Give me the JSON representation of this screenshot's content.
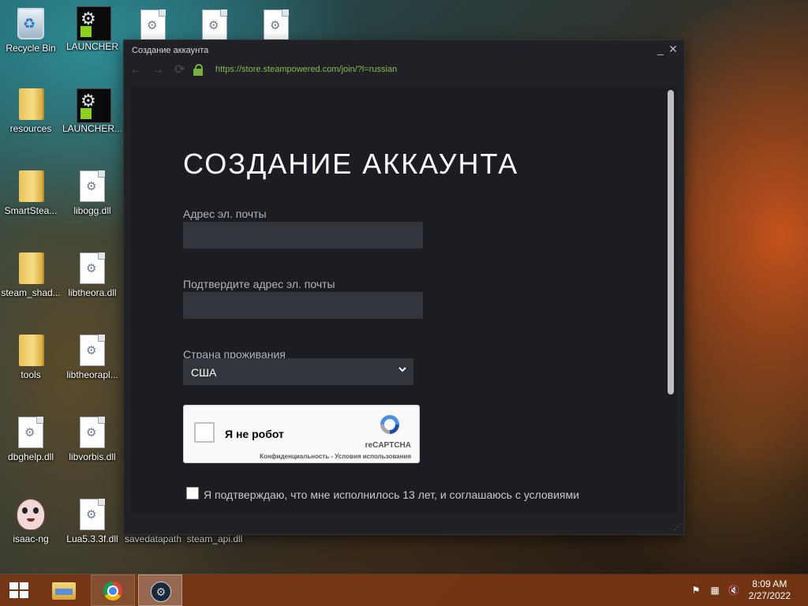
{
  "desktop": {
    "icons": [
      {
        "label": "Recycle Bin",
        "icon": "recycle-bin-icon"
      },
      {
        "label": "LAUNCHER",
        "icon": "steam-launcher-icon"
      },
      {
        "label": "resources",
        "icon": "folder-icon"
      },
      {
        "label": "LAUNCHER...",
        "icon": "steam-launcher-icon"
      },
      {
        "label": "SmartStea...",
        "icon": "folder-icon"
      },
      {
        "label": "libogg.dll",
        "icon": "dll-file-icon"
      },
      {
        "label": "steam_shad...",
        "icon": "folder-icon"
      },
      {
        "label": "libtheora.dll",
        "icon": "dll-file-icon"
      },
      {
        "label": "tools",
        "icon": "folder-icon"
      },
      {
        "label": "libtheorapl...",
        "icon": "dll-file-icon"
      },
      {
        "label": "dbghelp.dll",
        "icon": "dll-file-icon"
      },
      {
        "label": "libvorbis.dll",
        "icon": "dll-file-icon"
      },
      {
        "label": "isaac-ng",
        "icon": "isaac-game-icon"
      },
      {
        "label": "Lua5.3.3f.dll",
        "icon": "dll-file-icon"
      },
      {
        "label": "savedatapath",
        "icon": "file-icon"
      },
      {
        "label": "steam_api.dll",
        "icon": "dll-file-icon"
      }
    ]
  },
  "window": {
    "title": "Создание аккаунта",
    "url": "https://store.steampowered.com/join/?l=russian",
    "min_label": "_",
    "close_label": "✕"
  },
  "form": {
    "heading": "СОЗДАНИЕ АККАУНТА",
    "email_label": "Адрес эл. почты",
    "email_value": "",
    "confirm_label": "Подтвердите адрес эл. почты",
    "confirm_value": "",
    "country_label": "Страна проживания",
    "country_value": "США",
    "captcha": {
      "label": "Я не робот",
      "brand": "reCAPTCHA",
      "links": "Конфиденциальность - Условия использования"
    },
    "agree_text": "Я подтверждаю, что мне исполнилось 13 лет, и соглашаюсь с условиями"
  },
  "taskbar": {
    "time": "8:09 AM",
    "date": "2/27/2022"
  }
}
